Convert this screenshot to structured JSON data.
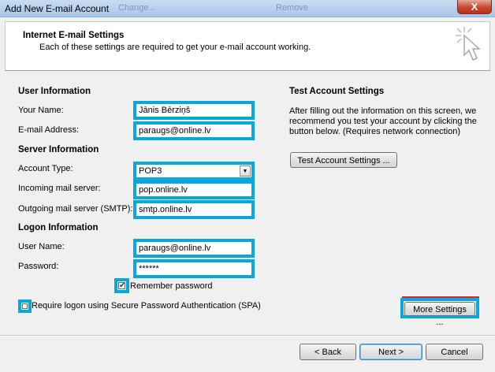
{
  "window": {
    "title": "Add New E-mail Account",
    "bg_hint_1": "Change...",
    "bg_hint_2": "Remove",
    "close_label": "X"
  },
  "header": {
    "title": "Internet E-mail Settings",
    "subtitle": "Each of these settings are required to get your e-mail account working."
  },
  "user_info": {
    "section_title": "User Information",
    "name_label": "Your Name:",
    "name_value": "Jānis Bērziņš",
    "email_label": "E-mail Address:",
    "email_value": "paraugs@online.lv"
  },
  "server_info": {
    "section_title": "Server Information",
    "account_type_label": "Account Type:",
    "account_type_value": "POP3",
    "incoming_label": "Incoming mail server:",
    "incoming_value": "pop.online.lv",
    "outgoing_label": "Outgoing mail server (SMTP):",
    "outgoing_value": "smtp.online.lv"
  },
  "logon_info": {
    "section_title": "Logon Information",
    "username_label": "User Name:",
    "username_value": "paraugs@online.lv",
    "password_label": "Password:",
    "password_value": "******",
    "remember_label": "Remember password",
    "remember_checked": true,
    "spa_label": "Require logon using Secure Password Authentication (SPA)",
    "spa_checked": false
  },
  "test": {
    "section_title": "Test Account Settings",
    "description_line1": "After filling out the information on this screen, we",
    "description_line2": "recommend you test your account by clicking the",
    "description_line3": "button below. (Requires network connection)",
    "button_label": "Test Account Settings ..."
  },
  "more_settings_label": "More Settings ...",
  "footer": {
    "back_label": "< Back",
    "next_label": "Next >",
    "cancel_label": "Cancel"
  },
  "colors": {
    "highlight": "#08a8dc",
    "title_bar": "#a9c6ea",
    "close_button": "#c8472f"
  },
  "icons": [
    "cursor-click-icon",
    "dropdown-arrow-icon",
    "checkmark-icon"
  ]
}
